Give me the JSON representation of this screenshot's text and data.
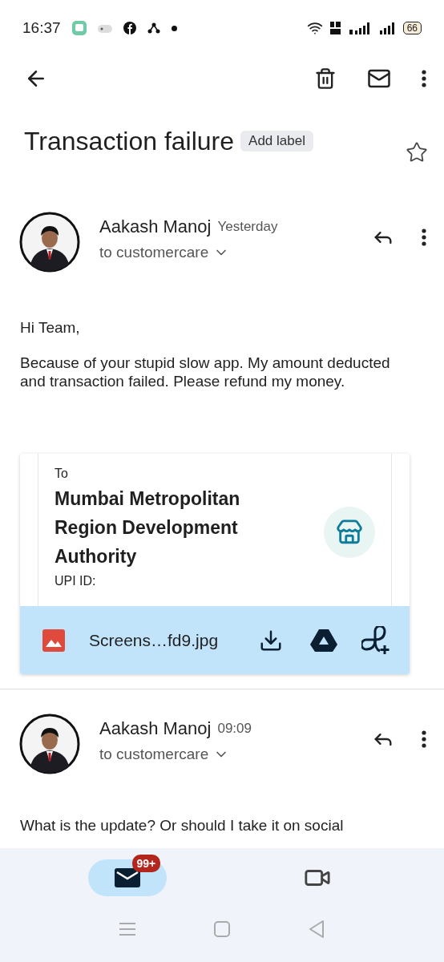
{
  "status_bar": {
    "time": "16:37",
    "battery": "66"
  },
  "subject": {
    "title": "Transaction failure",
    "label_button": "Add label",
    "starred": false
  },
  "messages": [
    {
      "sender": "Aakash Manoj",
      "time": "Yesterday",
      "recipient": "to customercare",
      "body": [
        "Hi Team,",
        "Because of your stupid slow app. My amount deducted and transaction failed. Please refund my money."
      ],
      "attachment": {
        "preview_to": "To",
        "preview_payee": "Mumbai Metropolitan Region Development Authority",
        "preview_upi": "UPI ID:",
        "file_name": "Screens…fd9.jpg"
      }
    },
    {
      "sender": "Aakash Manoj",
      "time": "09:09",
      "recipient": "to customercare",
      "body": [
        "What is the update? Or should I take it on social"
      ]
    }
  ],
  "bottom_nav": [
    {
      "kind": "mail",
      "badge": "99+",
      "selected": true
    },
    {
      "kind": "video",
      "selected": false
    }
  ]
}
